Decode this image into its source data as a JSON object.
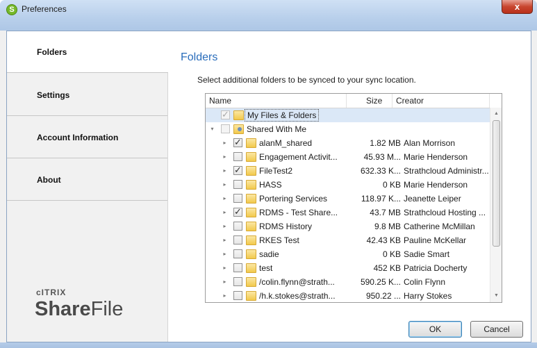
{
  "window": {
    "title": "Preferences",
    "app_icon": "sharefile-icon",
    "close_glyph": "x"
  },
  "sidebar": {
    "items": [
      {
        "label": "Folders",
        "active": true
      },
      {
        "label": "Settings",
        "active": false
      },
      {
        "label": "Account Information",
        "active": false
      },
      {
        "label": "About",
        "active": false
      }
    ],
    "brand_top": "cITRIX",
    "brand_bold": "Share",
    "brand_rest": "File"
  },
  "main": {
    "title": "Folders",
    "instruction": "Select additional folders to be synced to your sync location."
  },
  "tree": {
    "columns": {
      "name": "Name",
      "size": "Size",
      "creator": "Creator"
    },
    "rows": [
      {
        "name": "My Files & Folders",
        "size": "",
        "creator": "",
        "checked": true,
        "disabled": true,
        "level": 0,
        "expander": "",
        "selected": true
      },
      {
        "name": "Shared With Me",
        "size": "",
        "creator": "",
        "checked": false,
        "disabled": true,
        "level": 0,
        "expander": "▾",
        "shared": true
      },
      {
        "name": "alanM_shared",
        "size": "1.82 MB",
        "creator": "Alan Morrison",
        "checked": true,
        "level": 1,
        "expander": "▸"
      },
      {
        "name": "Engagement Activit...",
        "size": "45.93 M...",
        "creator": "Marie Henderson",
        "checked": false,
        "level": 1,
        "expander": "▸"
      },
      {
        "name": "FileTest2",
        "size": "632.33 K...",
        "creator": "Strathcloud Administr...",
        "checked": true,
        "level": 1,
        "expander": "▸"
      },
      {
        "name": "HASS",
        "size": "0 KB",
        "creator": "Marie Henderson",
        "checked": false,
        "level": 1,
        "expander": "▸"
      },
      {
        "name": "Portering Services",
        "size": "118.97 K...",
        "creator": "Jeanette Leiper",
        "checked": false,
        "level": 1,
        "expander": "▸"
      },
      {
        "name": "RDMS - Test Share...",
        "size": "43.7 MB",
        "creator": "Strathcloud  Hosting ...",
        "checked": true,
        "level": 1,
        "expander": "▸"
      },
      {
        "name": "RDMS History",
        "size": "9.8 MB",
        "creator": "Catherine McMillan",
        "checked": false,
        "level": 1,
        "expander": "▸"
      },
      {
        "name": "RKES Test",
        "size": "42.43 KB",
        "creator": "Pauline McKellar",
        "checked": false,
        "level": 1,
        "expander": "▸"
      },
      {
        "name": "sadie",
        "size": "0 KB",
        "creator": "Sadie Smart",
        "checked": false,
        "level": 1,
        "expander": "▸"
      },
      {
        "name": "test",
        "size": "452 KB",
        "creator": "Patricia Docherty",
        "checked": false,
        "level": 1,
        "expander": "▸"
      },
      {
        "name": "/colin.flynn@strath...",
        "size": "590.25 K...",
        "creator": "Colin Flynn",
        "checked": false,
        "level": 1,
        "expander": "▸"
      },
      {
        "name": "/h.k.stokes@strath...",
        "size": "950.22 ...",
        "creator": "Harry Stokes",
        "checked": false,
        "level": 1,
        "expander": "▸"
      }
    ]
  },
  "buttons": {
    "ok": "OK",
    "cancel": "Cancel"
  },
  "colors": {
    "section_title": "#2a6dbb",
    "selected_row": "#dbe8f7",
    "title_bar": "#b8cfeb",
    "close_button": "#c8462f"
  }
}
